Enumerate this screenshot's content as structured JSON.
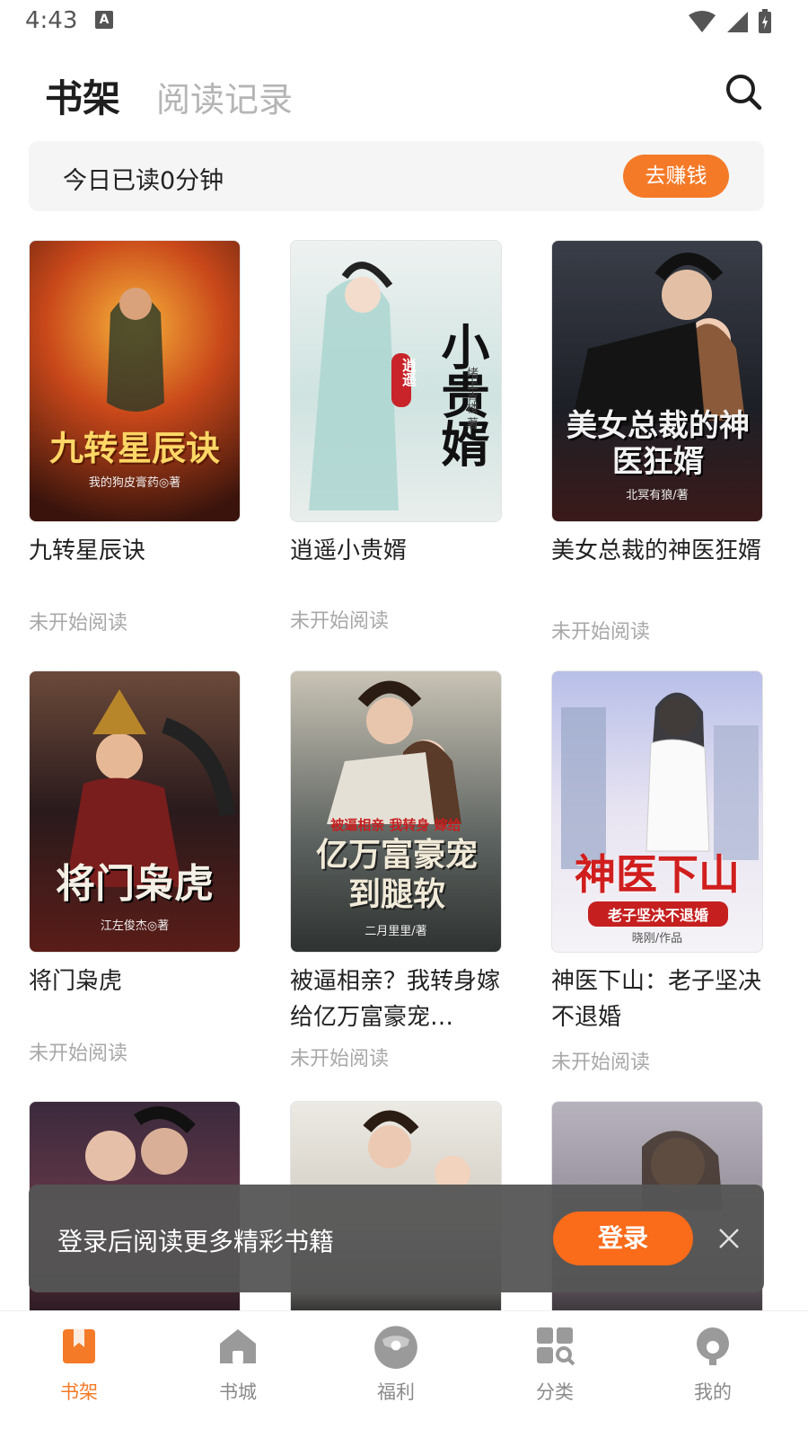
{
  "status_bar": {
    "time": "4:43",
    "notification_icon": "A"
  },
  "header": {
    "tab_active": "书架",
    "tab_inactive": "阅读记录",
    "search_icon": "search-icon"
  },
  "reading_banner": {
    "text": "今日已读0分钟",
    "button": "去赚钱"
  },
  "books": [
    {
      "title": "九转星辰诀",
      "status": "未开始阅读",
      "cover_title": "九转星辰诀",
      "cover_author": "我的狗皮膏药◎著"
    },
    {
      "title": "逍遥小贵婿",
      "status": "未开始阅读",
      "cover_title": "小贵婿",
      "cover_sub": "逍遥",
      "cover_author": "堵上青楼 著"
    },
    {
      "title": "美女总裁的神医狂婿",
      "status": "未开始阅读",
      "cover_title": "美女总裁的神医狂婿",
      "cover_author": "北冥有狼/著"
    },
    {
      "title": "将门枭虎",
      "status": "未开始阅读",
      "cover_title": "将门枭虎",
      "cover_author": "江左俊杰◎著"
    },
    {
      "title": "被逼相亲？我转身嫁给亿万富豪宠…",
      "status": "未开始阅读",
      "cover_title": "亿万富豪宠到腿软",
      "cover_sub": "被逼相亲 我转身 嫁给",
      "cover_author": "二月里里/著"
    },
    {
      "title": "神医下山：老子坚决不退婚",
      "status": "未开始阅读",
      "cover_title": "神医下山",
      "cover_sub": "老子坚决不退婚",
      "cover_author": "晓刚/作品"
    }
  ],
  "login_toast": {
    "text": "登录后阅读更多精彩书籍",
    "button": "登录"
  },
  "bottom_nav": [
    {
      "label": "书架",
      "icon": "bookshelf-icon",
      "active": true
    },
    {
      "label": "书城",
      "icon": "home-icon",
      "active": false
    },
    {
      "label": "福利",
      "icon": "gift-bag-icon",
      "active": false
    },
    {
      "label": "分类",
      "icon": "category-icon",
      "active": false
    },
    {
      "label": "我的",
      "icon": "profile-icon",
      "active": false
    }
  ],
  "colors": {
    "accent": "#f47a28",
    "login_button": "#fa6b1a",
    "muted": "#a8a8a8"
  }
}
